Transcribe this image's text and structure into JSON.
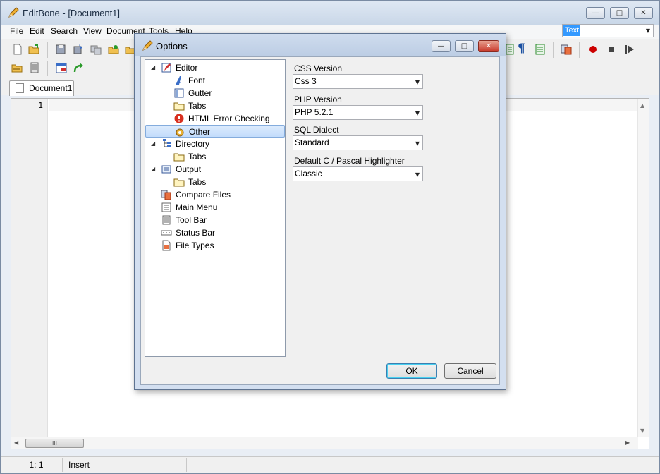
{
  "window": {
    "title": "EditBone - [Document1]",
    "caption_minimize": "—",
    "caption_maximize": "□",
    "caption_close": "✕"
  },
  "menu": [
    "File",
    "Edit",
    "Search",
    "View",
    "Document",
    "Tools",
    "Help"
  ],
  "highlighter": {
    "value": "Text"
  },
  "toolbar": {
    "icons": [
      "new-file-icon",
      "open-file-icon",
      "save-icon",
      "save-as-icon",
      "save-all-icon",
      "open-folder-icon",
      "folder-icon",
      "open-recent-icon",
      "file-properties-icon",
      "calendar-icon",
      "redo-icon",
      "word-wrap-icon",
      "paragraph-icon",
      "line-numbers-icon",
      "compare-icon",
      "record-macro-icon",
      "stop-macro-icon",
      "play-macro-icon"
    ]
  },
  "tabs": [
    {
      "label": "Document1"
    }
  ],
  "editor": {
    "line_number": "1"
  },
  "hscroll": {
    "grip": "III"
  },
  "status": {
    "position": "1: 1",
    "mode": "Insert"
  },
  "dialog": {
    "title": "Options",
    "tree": [
      {
        "label": "Editor",
        "icon": "editor-icon",
        "level": 0,
        "expanded": true
      },
      {
        "label": "Font",
        "icon": "font-icon",
        "level": 1
      },
      {
        "label": "Gutter",
        "icon": "gutter-icon",
        "level": 1
      },
      {
        "label": "Tabs",
        "icon": "tabs-icon",
        "level": 1
      },
      {
        "label": "HTML Error Checking",
        "icon": "error-icon",
        "level": 1
      },
      {
        "label": "Other",
        "icon": "other-icon",
        "level": 1,
        "selected": true
      },
      {
        "label": "Directory",
        "icon": "directory-icon",
        "level": 0,
        "expanded": true
      },
      {
        "label": "Tabs",
        "icon": "tabs-icon",
        "level": 1
      },
      {
        "label": "Output",
        "icon": "output-icon",
        "level": 0,
        "expanded": true
      },
      {
        "label": "Tabs",
        "icon": "tabs-icon",
        "level": 1
      },
      {
        "label": "Compare Files",
        "icon": "compare-files-icon",
        "level": 0
      },
      {
        "label": "Main Menu",
        "icon": "main-menu-icon",
        "level": 0
      },
      {
        "label": "Tool Bar",
        "icon": "tool-bar-icon",
        "level": 0
      },
      {
        "label": "Status Bar",
        "icon": "status-bar-icon",
        "level": 0
      },
      {
        "label": "File Types",
        "icon": "file-types-icon",
        "level": 0
      }
    ],
    "fields": [
      {
        "label": "CSS Version",
        "value": "Css 3"
      },
      {
        "label": "PHP Version",
        "value": "PHP 5.2.1"
      },
      {
        "label": "SQL Dialect",
        "value": "Standard"
      },
      {
        "label": "Default C / Pascal Highlighter",
        "value": "Classic"
      }
    ],
    "ok_label": "OK",
    "cancel_label": "Cancel"
  },
  "colors": {
    "selection": "#3399ff",
    "dialog_frame": "#d3dff0",
    "tree_selected": "#c2dcfb",
    "record": "#cc0000"
  }
}
